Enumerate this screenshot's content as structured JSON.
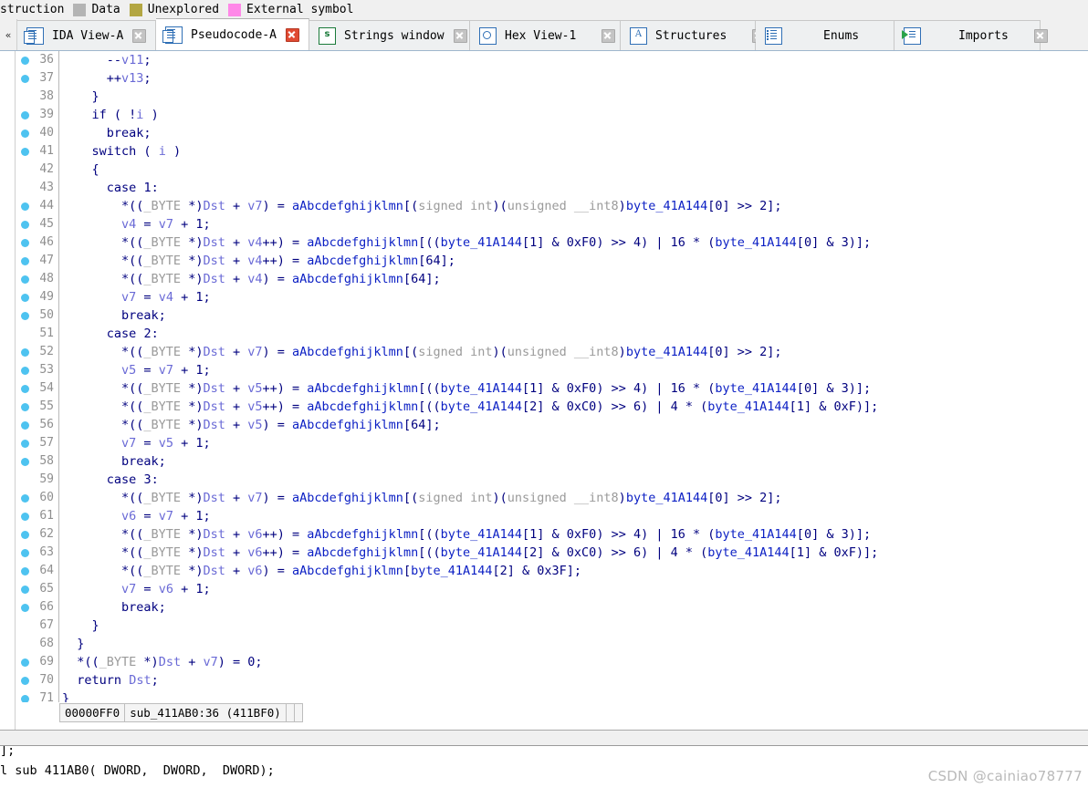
{
  "legend": {
    "truncated_prefix": "struction",
    "items": [
      {
        "label": "Data",
        "color": "#b4b4b4"
      },
      {
        "label": "Unexplored",
        "color": "#b3a642"
      },
      {
        "label": "External symbol",
        "color": "#ff88e8"
      }
    ]
  },
  "tabbar": {
    "scroll_left_glyph": "«",
    "tabs": [
      {
        "label": "IDA View-A",
        "icon": "document-icon",
        "active": false,
        "close_style": "grey"
      },
      {
        "label": "Pseudocode-A",
        "icon": "document-icon",
        "active": true,
        "close_style": "red"
      },
      {
        "label": "Strings window",
        "icon": "strings-icon",
        "active": false,
        "close_style": "grey"
      },
      {
        "label": "Hex View-1",
        "icon": "hex-view-icon",
        "active": false,
        "close_style": "grey"
      },
      {
        "label": "Structures",
        "icon": "structures-icon",
        "active": false,
        "close_style": "grey"
      },
      {
        "label": "Enums",
        "icon": "enums-icon",
        "active": false,
        "close_style": "grey"
      },
      {
        "label": "Imports",
        "icon": "imports-icon",
        "active": false,
        "close_style": "grey"
      }
    ]
  },
  "pseudocode": {
    "lines": [
      {
        "n": "36",
        "bp": true,
        "html": "<span class='p'>      --</span><span class='var'>v11</span><span class='p'>;</span>"
      },
      {
        "n": "37",
        "bp": true,
        "html": "<span class='p'>      ++</span><span class='var'>v13</span><span class='p'>;</span>"
      },
      {
        "n": "38",
        "bp": false,
        "html": "<span class='p'>    }</span>"
      },
      {
        "n": "39",
        "bp": true,
        "html": "<span class='p'>    </span><span class='k'>if</span><span class='p'> ( !</span><span class='var'>i</span><span class='p'> )</span>"
      },
      {
        "n": "40",
        "bp": true,
        "html": "<span class='p'>      </span><span class='k'>break</span><span class='p'>;</span>"
      },
      {
        "n": "41",
        "bp": true,
        "html": "<span class='p'>    </span><span class='k'>switch</span><span class='p'> ( </span><span class='var'>i</span><span class='p'> )</span>"
      },
      {
        "n": "42",
        "bp": false,
        "html": "<span class='p'>    {</span>"
      },
      {
        "n": "43",
        "bp": false,
        "html": "<span class='p'>      </span><span class='k'>case</span><span class='p'> </span><span class='num'>1</span><span class='p'>:</span>"
      },
      {
        "n": "44",
        "bp": true,
        "html": "<span class='p'>        *((</span><span class='typ'>_BYTE </span><span class='p'>*)</span><span class='var'>Dst</span><span class='p'> + </span><span class='var'>v7</span><span class='p'>) = </span><span class='glb'>aAbcdefghijklmn</span><span class='p'>[(</span><span class='typ'>signed int</span><span class='p'>)(</span><span class='typ'>unsigned __int8</span><span class='p'>)</span><span class='glb'>byte_41A144</span><span class='p'>[</span><span class='num'>0</span><span class='p'>] >> </span><span class='num'>2</span><span class='p'>];</span>"
      },
      {
        "n": "45",
        "bp": true,
        "html": "<span class='p'>        </span><span class='var'>v4</span><span class='p'> = </span><span class='var'>v7</span><span class='p'> + </span><span class='num'>1</span><span class='p'>;</span>"
      },
      {
        "n": "46",
        "bp": true,
        "html": "<span class='p'>        *((</span><span class='typ'>_BYTE </span><span class='p'>*)</span><span class='var'>Dst</span><span class='p'> + </span><span class='var'>v4</span><span class='p'>++) = </span><span class='glb'>aAbcdefghijklmn</span><span class='p'>[((</span><span class='glb'>byte_41A144</span><span class='p'>[</span><span class='num'>1</span><span class='p'>] &amp; </span><span class='num'>0xF0</span><span class='p'>) >> </span><span class='num'>4</span><span class='p'>) | </span><span class='num'>16</span><span class='p'> * (</span><span class='glb'>byte_41A144</span><span class='p'>[</span><span class='num'>0</span><span class='p'>] &amp; </span><span class='num'>3</span><span class='p'>)];</span>"
      },
      {
        "n": "47",
        "bp": true,
        "html": "<span class='p'>        *((</span><span class='typ'>_BYTE </span><span class='p'>*)</span><span class='var'>Dst</span><span class='p'> + </span><span class='var'>v4</span><span class='p'>++) = </span><span class='glb'>aAbcdefghijklmn</span><span class='p'>[</span><span class='num'>64</span><span class='p'>];</span>"
      },
      {
        "n": "48",
        "bp": true,
        "html": "<span class='p'>        *((</span><span class='typ'>_BYTE </span><span class='p'>*)</span><span class='var'>Dst</span><span class='p'> + </span><span class='var'>v4</span><span class='p'>) = </span><span class='glb'>aAbcdefghijklmn</span><span class='p'>[</span><span class='num'>64</span><span class='p'>];</span>"
      },
      {
        "n": "49",
        "bp": true,
        "html": "<span class='p'>        </span><span class='var'>v7</span><span class='p'> = </span><span class='var'>v4</span><span class='p'> + </span><span class='num'>1</span><span class='p'>;</span>"
      },
      {
        "n": "50",
        "bp": true,
        "html": "<span class='p'>        </span><span class='k'>break</span><span class='p'>;</span>"
      },
      {
        "n": "51",
        "bp": false,
        "html": "<span class='p'>      </span><span class='k'>case</span><span class='p'> </span><span class='num'>2</span><span class='p'>:</span>"
      },
      {
        "n": "52",
        "bp": true,
        "html": "<span class='p'>        *((</span><span class='typ'>_BYTE </span><span class='p'>*)</span><span class='var'>Dst</span><span class='p'> + </span><span class='var'>v7</span><span class='p'>) = </span><span class='glb'>aAbcdefghijklmn</span><span class='p'>[(</span><span class='typ'>signed int</span><span class='p'>)(</span><span class='typ'>unsigned __int8</span><span class='p'>)</span><span class='glb'>byte_41A144</span><span class='p'>[</span><span class='num'>0</span><span class='p'>] >> </span><span class='num'>2</span><span class='p'>];</span>"
      },
      {
        "n": "53",
        "bp": true,
        "html": "<span class='p'>        </span><span class='var'>v5</span><span class='p'> = </span><span class='var'>v7</span><span class='p'> + </span><span class='num'>1</span><span class='p'>;</span>"
      },
      {
        "n": "54",
        "bp": true,
        "html": "<span class='p'>        *((</span><span class='typ'>_BYTE </span><span class='p'>*)</span><span class='var'>Dst</span><span class='p'> + </span><span class='var'>v5</span><span class='p'>++) = </span><span class='glb'>aAbcdefghijklmn</span><span class='p'>[((</span><span class='glb'>byte_41A144</span><span class='p'>[</span><span class='num'>1</span><span class='p'>] &amp; </span><span class='num'>0xF0</span><span class='p'>) >> </span><span class='num'>4</span><span class='p'>) | </span><span class='num'>16</span><span class='p'> * (</span><span class='glb'>byte_41A144</span><span class='p'>[</span><span class='num'>0</span><span class='p'>] &amp; </span><span class='num'>3</span><span class='p'>)];</span>"
      },
      {
        "n": "55",
        "bp": true,
        "html": "<span class='p'>        *((</span><span class='typ'>_BYTE </span><span class='p'>*)</span><span class='var'>Dst</span><span class='p'> + </span><span class='var'>v5</span><span class='p'>++) = </span><span class='glb'>aAbcdefghijklmn</span><span class='p'>[((</span><span class='glb'>byte_41A144</span><span class='p'>[</span><span class='num'>2</span><span class='p'>] &amp; </span><span class='num'>0xC0</span><span class='p'>) >> </span><span class='num'>6</span><span class='p'>) | </span><span class='num'>4</span><span class='p'> * (</span><span class='glb'>byte_41A144</span><span class='p'>[</span><span class='num'>1</span><span class='p'>] &amp; </span><span class='num'>0xF</span><span class='p'>)];</span>"
      },
      {
        "n": "56",
        "bp": true,
        "html": "<span class='p'>        *((</span><span class='typ'>_BYTE </span><span class='p'>*)</span><span class='var'>Dst</span><span class='p'> + </span><span class='var'>v5</span><span class='p'>) = </span><span class='glb'>aAbcdefghijklmn</span><span class='p'>[</span><span class='num'>64</span><span class='p'>];</span>"
      },
      {
        "n": "57",
        "bp": true,
        "html": "<span class='p'>        </span><span class='var'>v7</span><span class='p'> = </span><span class='var'>v5</span><span class='p'> + </span><span class='num'>1</span><span class='p'>;</span>"
      },
      {
        "n": "58",
        "bp": true,
        "html": "<span class='p'>        </span><span class='k'>break</span><span class='p'>;</span>"
      },
      {
        "n": "59",
        "bp": false,
        "html": "<span class='p'>      </span><span class='k'>case</span><span class='p'> </span><span class='num'>3</span><span class='p'>:</span>"
      },
      {
        "n": "60",
        "bp": true,
        "html": "<span class='p'>        *((</span><span class='typ'>_BYTE </span><span class='p'>*)</span><span class='var'>Dst</span><span class='p'> + </span><span class='var'>v7</span><span class='p'>) = </span><span class='glb'>aAbcdefghijklmn</span><span class='p'>[(</span><span class='typ'>signed int</span><span class='p'>)(</span><span class='typ'>unsigned __int8</span><span class='p'>)</span><span class='glb'>byte_41A144</span><span class='p'>[</span><span class='num'>0</span><span class='p'>] >> </span><span class='num'>2</span><span class='p'>];</span>"
      },
      {
        "n": "61",
        "bp": true,
        "html": "<span class='p'>        </span><span class='var'>v6</span><span class='p'> = </span><span class='var'>v7</span><span class='p'> + </span><span class='num'>1</span><span class='p'>;</span>"
      },
      {
        "n": "62",
        "bp": true,
        "html": "<span class='p'>        *((</span><span class='typ'>_BYTE </span><span class='p'>*)</span><span class='var'>Dst</span><span class='p'> + </span><span class='var'>v6</span><span class='p'>++) = </span><span class='glb'>aAbcdefghijklmn</span><span class='p'>[((</span><span class='glb'>byte_41A144</span><span class='p'>[</span><span class='num'>1</span><span class='p'>] &amp; </span><span class='num'>0xF0</span><span class='p'>) >> </span><span class='num'>4</span><span class='p'>) | </span><span class='num'>16</span><span class='p'> * (</span><span class='glb'>byte_41A144</span><span class='p'>[</span><span class='num'>0</span><span class='p'>] &amp; </span><span class='num'>3</span><span class='p'>)];</span>"
      },
      {
        "n": "63",
        "bp": true,
        "html": "<span class='p'>        *((</span><span class='typ'>_BYTE </span><span class='p'>*)</span><span class='var'>Dst</span><span class='p'> + </span><span class='var'>v6</span><span class='p'>++) = </span><span class='glb'>aAbcdefghijklmn</span><span class='p'>[((</span><span class='glb'>byte_41A144</span><span class='p'>[</span><span class='num'>2</span><span class='p'>] &amp; </span><span class='num'>0xC0</span><span class='p'>) >> </span><span class='num'>6</span><span class='p'>) | </span><span class='num'>4</span><span class='p'> * (</span><span class='glb'>byte_41A144</span><span class='p'>[</span><span class='num'>1</span><span class='p'>] &amp; </span><span class='num'>0xF</span><span class='p'>)];</span>"
      },
      {
        "n": "64",
        "bp": true,
        "html": "<span class='p'>        *((</span><span class='typ'>_BYTE </span><span class='p'>*)</span><span class='var'>Dst</span><span class='p'> + </span><span class='var'>v6</span><span class='p'>) = </span><span class='glb'>aAbcdefghijklmn</span><span class='p'>[</span><span class='glb'>byte_41A144</span><span class='p'>[</span><span class='num'>2</span><span class='p'>] &amp; </span><span class='num'>0x3F</span><span class='p'>];</span>"
      },
      {
        "n": "65",
        "bp": true,
        "html": "<span class='p'>        </span><span class='var'>v7</span><span class='p'> = </span><span class='var'>v6</span><span class='p'> + </span><span class='num'>1</span><span class='p'>;</span>"
      },
      {
        "n": "66",
        "bp": true,
        "html": "<span class='p'>        </span><span class='k'>break</span><span class='p'>;</span>"
      },
      {
        "n": "67",
        "bp": false,
        "html": "<span class='p'>    }</span>"
      },
      {
        "n": "68",
        "bp": false,
        "html": "<span class='p'>  }</span>"
      },
      {
        "n": "69",
        "bp": true,
        "html": "<span class='p'>  *((</span><span class='typ'>_BYTE </span><span class='p'>*)</span><span class='var'>Dst</span><span class='p'> + </span><span class='var'>v7</span><span class='p'>) = </span><span class='num'>0</span><span class='p'>;</span>"
      },
      {
        "n": "70",
        "bp": true,
        "html": "<span class='p'>  </span><span class='k'>return</span><span class='p'> </span><span class='var'>Dst</span><span class='p'>;</span>"
      },
      {
        "n": "71",
        "bp": true,
        "html": "<span class='p'>}</span>"
      }
    ],
    "status": {
      "offset": "00000FF0",
      "location": "sub_411AB0:36  (411BF0)"
    }
  },
  "output_window": {
    "line1": "];",
    "line2": "l sub 411AB0( DWORD,  DWORD,  DWORD);"
  },
  "watermark": "CSDN @cainiao78777"
}
